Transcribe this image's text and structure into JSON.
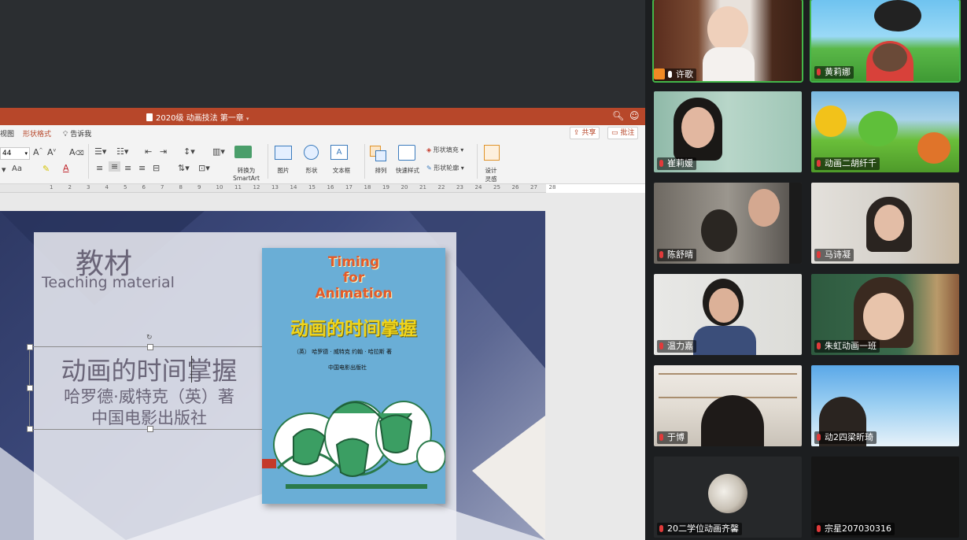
{
  "ppt": {
    "doc_title": "2020级 动画技法 第一章",
    "menu": {
      "view_partial": "视图",
      "shape_format": "形状格式",
      "tell_me": "告诉我",
      "share": "共享",
      "comment": "批注"
    },
    "ribbon": {
      "font_size": "44",
      "case_label": "Aa",
      "convert_smartart_line1": "转换为",
      "convert_smartart_line2": "SmartArt",
      "picture": "图片",
      "shape": "形状",
      "textbox": "文本框",
      "arrange": "排列",
      "quick_styles": "快速样式",
      "shape_fill": "形状填充",
      "shape_outline": "形状轮廓",
      "design_ideas_line1": "设计",
      "design_ideas_line2": "灵感"
    },
    "ruler": [
      "1",
      "2",
      "3",
      "4",
      "5",
      "6",
      "7",
      "8",
      "9",
      "10",
      "11",
      "12",
      "13",
      "14",
      "15",
      "16",
      "17",
      "18",
      "19",
      "20",
      "21",
      "22",
      "23",
      "24",
      "25",
      "26",
      "27",
      "28"
    ]
  },
  "slide": {
    "title": "教材",
    "subtitle": "Teaching material",
    "book_title": "动画的时间掌握",
    "author": "哈罗德·威特克（英）著",
    "publisher": "中国电影出版社",
    "cover": {
      "en_line1": "Timing",
      "en_line2": "for",
      "en_line3": "Animation",
      "cn_title": "动画的时间掌握",
      "authors": "（英）  哈罗德 · 威特克  约翰 · 哈拉斯  著",
      "publisher": "中国电影出版社"
    }
  },
  "participants": [
    {
      "name": "许歌",
      "host": true,
      "speaking": true
    },
    {
      "name": "黄莉娜"
    },
    {
      "name": "崔莉媛"
    },
    {
      "name": "动画二胡纤千"
    },
    {
      "name": "陈舒晴"
    },
    {
      "name": "马诗凝"
    },
    {
      "name": "温力嘉"
    },
    {
      "name": "朱虹动画一班"
    },
    {
      "name": "于博"
    },
    {
      "name": "动2四梁昕琦"
    },
    {
      "name": "20二学位动画齐馨"
    },
    {
      "name": "宗星207030316"
    }
  ]
}
